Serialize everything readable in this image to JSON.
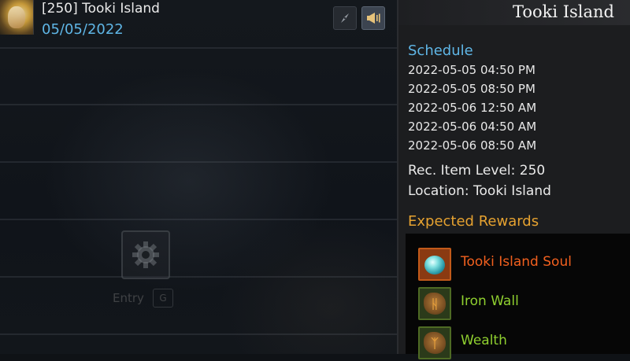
{
  "raid": {
    "title": "[250] Tooki Island",
    "date": "05/05/2022"
  },
  "left_panel": {
    "entry_label": "Entry",
    "entry_key": "G"
  },
  "detail": {
    "title": "Tooki Island",
    "schedule_heading": "Schedule",
    "schedule": [
      "2022-05-05 04:50 PM",
      "2022-05-05 08:50 PM",
      "2022-05-06 12:50 AM",
      "2022-05-06 04:50 AM",
      "2022-05-06 08:50 AM"
    ],
    "rec_item_level": "Rec. Item Level: 250",
    "location": "Location: Tooki Island",
    "rewards_heading": "Expected Rewards",
    "rewards": [
      {
        "name": "Tooki Island Soul",
        "icon": "soul-orb-icon",
        "color": "#f2601e"
      },
      {
        "name": "Iron Wall",
        "icon": "iron-wall-rune-icon",
        "color": "#8fcf2f"
      },
      {
        "name": "Wealth",
        "icon": "wealth-rune-icon",
        "color": "#8fcf2f"
      }
    ]
  },
  "icons": {
    "compass": "compass-icon",
    "announce": "megaphone-icon",
    "settings": "gear-icon",
    "avatar": "raid-avatar"
  },
  "colors": {
    "date_blue": "#5fb6e6",
    "rewards_heading": "#e6a230",
    "legendary_orange": "#f2601e",
    "rare_green": "#8fcf2f"
  }
}
